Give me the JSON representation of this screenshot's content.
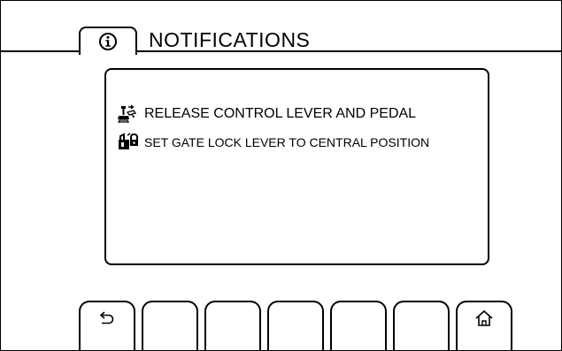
{
  "header": {
    "title": "NOTIFICATIONS",
    "tab_icon": "info-icon"
  },
  "messages": [
    {
      "icon": "control-lever-pedal-icon",
      "text": "RELEASE CONTROL LEVER AND PEDAL"
    },
    {
      "icon": "gate-lock-lever-icon",
      "text": "SET GATE LOCK LEVER TO CENTRAL POSITION"
    }
  ],
  "softkeys": [
    {
      "icon": "back-icon"
    },
    {
      "icon": ""
    },
    {
      "icon": ""
    },
    {
      "icon": ""
    },
    {
      "icon": ""
    },
    {
      "icon": ""
    },
    {
      "icon": "home-icon"
    }
  ]
}
